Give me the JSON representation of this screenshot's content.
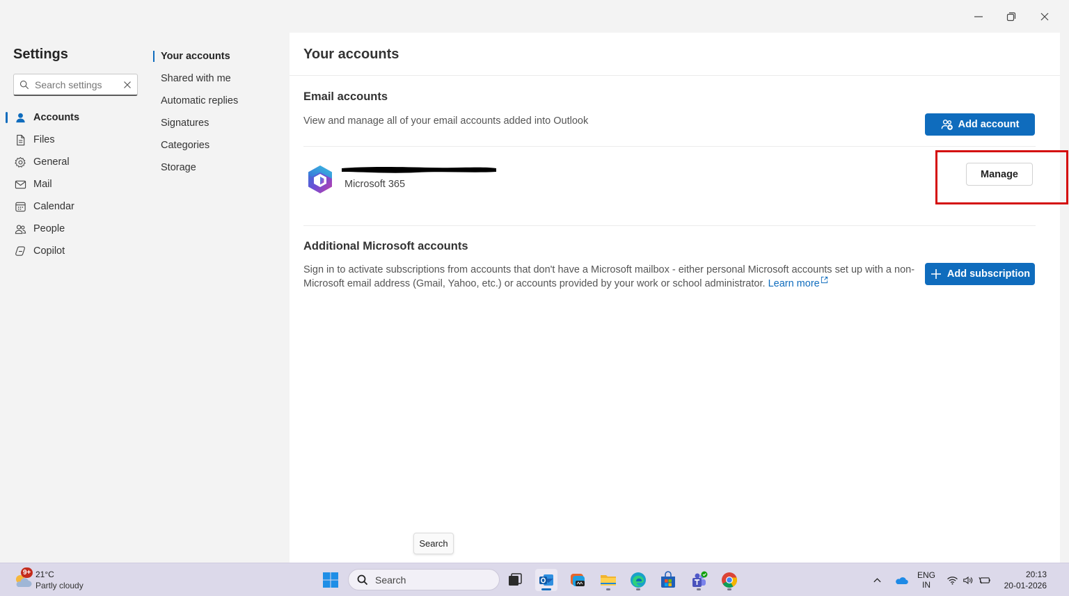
{
  "window": {
    "minimize_icon": "minimize-icon",
    "restore_icon": "restore-icon",
    "close_icon": "close-icon"
  },
  "sidebar": {
    "title": "Settings",
    "search": {
      "placeholder": "Search settings",
      "value": ""
    },
    "items": [
      {
        "label": "Accounts",
        "icon": "person-icon",
        "active": true
      },
      {
        "label": "Files",
        "icon": "document-icon",
        "active": false
      },
      {
        "label": "General",
        "icon": "gear-icon",
        "active": false
      },
      {
        "label": "Mail",
        "icon": "mail-icon",
        "active": false
      },
      {
        "label": "Calendar",
        "icon": "calendar-icon",
        "active": false
      },
      {
        "label": "People",
        "icon": "people-icon",
        "active": false
      },
      {
        "label": "Copilot",
        "icon": "copilot-icon",
        "active": false
      }
    ]
  },
  "subnav": {
    "items": [
      {
        "label": "Your accounts",
        "active": true
      },
      {
        "label": "Shared with me",
        "active": false
      },
      {
        "label": "Automatic replies",
        "active": false
      },
      {
        "label": "Signatures",
        "active": false
      },
      {
        "label": "Categories",
        "active": false
      },
      {
        "label": "Storage",
        "active": false
      }
    ]
  },
  "main": {
    "title": "Your accounts",
    "email_accounts": {
      "title": "Email accounts",
      "description": "View and manage all of your email accounts added into Outlook",
      "add_button": "Add account",
      "account": {
        "type": "Microsoft 365",
        "manage_button": "Manage"
      }
    },
    "additional": {
      "title": "Additional Microsoft accounts",
      "description_line1": "Sign in to activate subscriptions from accounts that don't have a Microsoft mailbox - either personal Microsoft accounts set up with a non-",
      "description_line2": "Microsoft email address (Gmail, Yahoo, etc.) or accounts provided by your work or school administrator.",
      "learn_more": "Learn more",
      "add_button": "Add subscription"
    }
  },
  "tooltip": {
    "text": "Search"
  },
  "taskbar": {
    "weather": {
      "badge": "9+",
      "temp": "21°C",
      "condition": "Partly cloudy"
    },
    "search_placeholder": "Search",
    "language": {
      "line1": "ENG",
      "line2": "IN"
    },
    "clock": {
      "time": "20:13",
      "date": "20-01-2026"
    }
  },
  "colors": {
    "accent": "#0f6cbd",
    "highlight": "#d40c0c",
    "taskbar": "#dcd9ea"
  }
}
